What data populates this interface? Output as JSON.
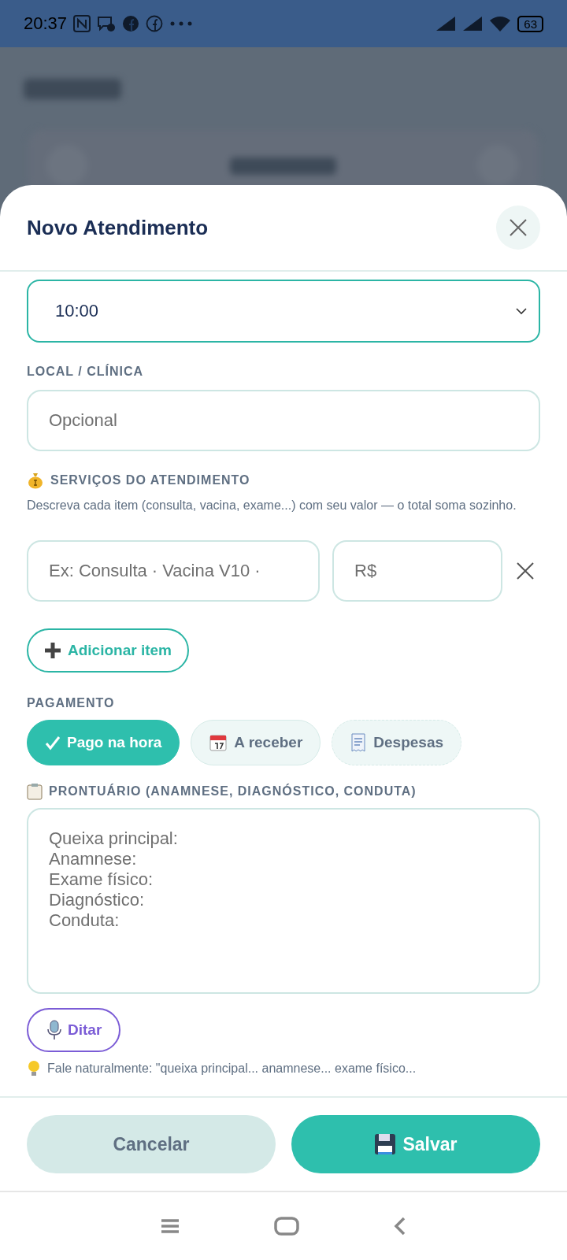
{
  "status_bar": {
    "time": "20:37",
    "battery": "63"
  },
  "sheet": {
    "title": "Novo Atendimento"
  },
  "time_field": {
    "value": "10:00"
  },
  "location": {
    "label": "LOCAL / CLÍNICA",
    "placeholder": "Opcional"
  },
  "services": {
    "label": "SERVIÇOS DO ATENDIMENTO",
    "description": "Descreva cada item (consulta, vacina, exame...) com seu valor — o total soma sozinho.",
    "items": [
      {
        "description_placeholder": "Ex: Consulta · Vacina V10 ·",
        "price_placeholder": "R$"
      }
    ],
    "add_button": "Adicionar item"
  },
  "payment": {
    "label": "PAGAMENTO",
    "options": [
      {
        "label": "Pago na hora",
        "kind": "paid",
        "selected": true
      },
      {
        "label": "A receber",
        "kind": "receivable",
        "selected": false
      },
      {
        "label": "Despesas",
        "kind": "expense",
        "selected": false
      }
    ]
  },
  "record": {
    "label": "PRONTUÁRIO (ANAMNESE, DIAGNÓSTICO, CONDUTA)",
    "placeholder": "Queixa principal:\nAnamnese:\nExame físico:\nDiagnóstico:\nConduta:",
    "dictate_button": "Ditar",
    "hint": "Fale naturalmente: \"queixa principal... anamnese... exame físico..."
  },
  "footer": {
    "buttons": [
      {
        "label": "Cancelar",
        "kind": "secondary"
      },
      {
        "label": "Salvar",
        "kind": "primary"
      }
    ]
  }
}
